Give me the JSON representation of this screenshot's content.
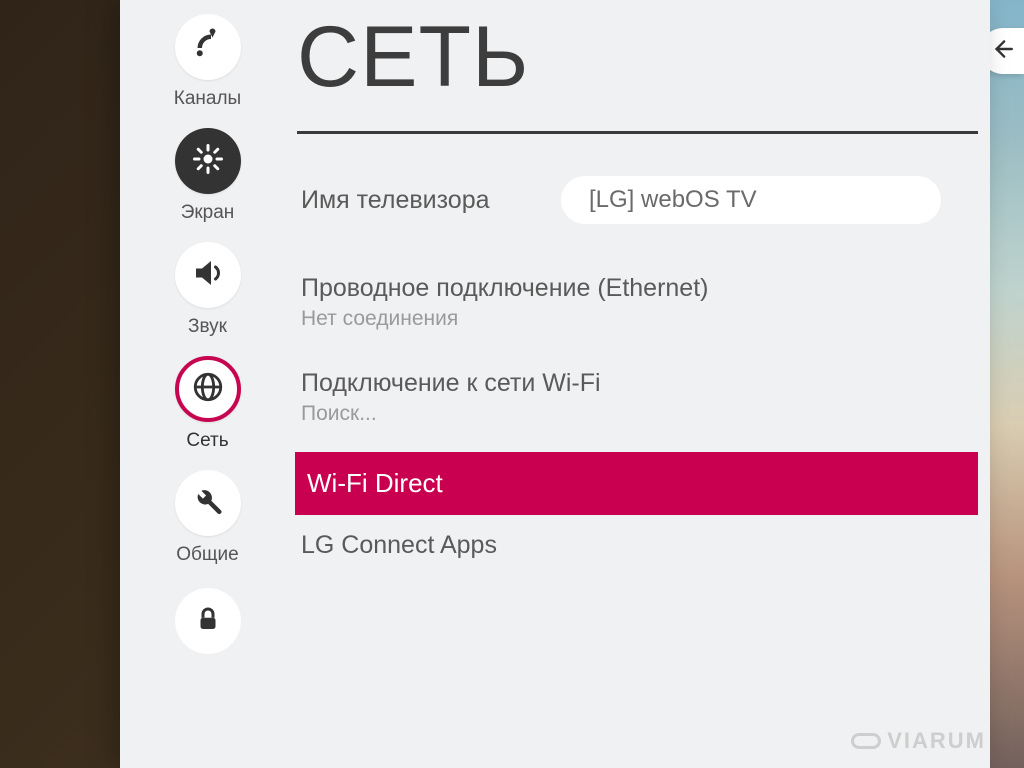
{
  "page_title": "СЕТЬ",
  "sidebar": {
    "items": [
      {
        "label": "Каналы",
        "icon": "satellite"
      },
      {
        "label": "Экран",
        "icon": "screen"
      },
      {
        "label": "Звук",
        "icon": "sound"
      },
      {
        "label": "Сеть",
        "icon": "network",
        "active": true
      },
      {
        "label": "Общие",
        "icon": "tools"
      }
    ],
    "lock_icon": "lock"
  },
  "content": {
    "tv_name": {
      "label": "Имя телевизора",
      "value": "[LG] webOS TV"
    },
    "ethernet": {
      "title": "Проводное подключение (Ethernet)",
      "status": "Нет соединения"
    },
    "wifi": {
      "title": "Подключение к сети Wi-Fi",
      "status": "Поиск..."
    },
    "wifi_direct": {
      "title": "Wi-Fi Direct",
      "selected": true
    },
    "lg_connect": {
      "title": "LG Connect Apps"
    }
  },
  "watermark": "VIARUM"
}
